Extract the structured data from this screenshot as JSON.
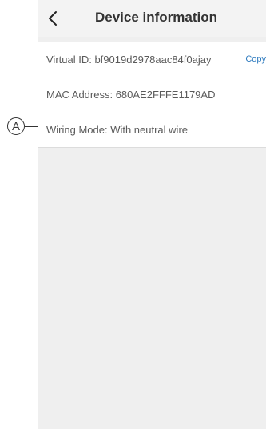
{
  "header": {
    "title": "Device information",
    "back_icon": "chevron-left-icon"
  },
  "info": {
    "virtual_id": "Virtual ID: bf9019d2978aac84f0ajay",
    "copy_label": "Copy",
    "mac_address": "MAC Address: 680AE2FFFE1179AD",
    "wiring_mode": "Wiring Mode: With neutral wire"
  },
  "annotation": {
    "callout_letter": "A"
  },
  "colors": {
    "link": "#2f7bbf",
    "background": "#efefef",
    "text": "#5a5a5a"
  }
}
